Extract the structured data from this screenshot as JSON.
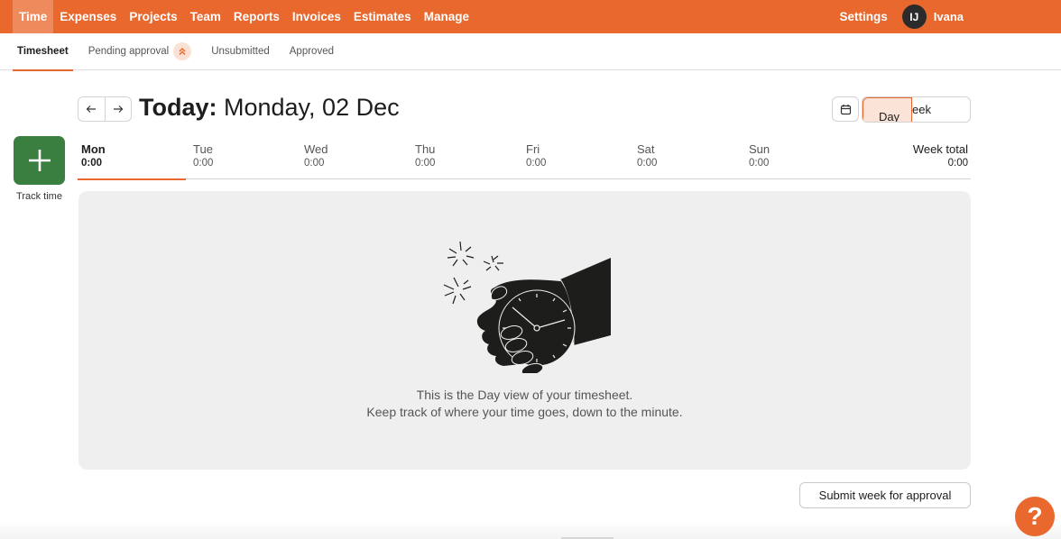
{
  "topnav": {
    "items": [
      {
        "label": "Time",
        "active": true
      },
      {
        "label": "Expenses"
      },
      {
        "label": "Projects"
      },
      {
        "label": "Team"
      },
      {
        "label": "Reports"
      },
      {
        "label": "Invoices"
      },
      {
        "label": "Estimates"
      },
      {
        "label": "Manage"
      }
    ],
    "settings_label": "Settings",
    "user": {
      "initials": "IJ",
      "name": "Ivana"
    }
  },
  "subnav": {
    "items": [
      {
        "label": "Timesheet",
        "active": true
      },
      {
        "label": "Pending approval",
        "badge_icon": "double-chevron-up-icon"
      },
      {
        "label": "Unsubmitted"
      },
      {
        "label": "Approved"
      }
    ]
  },
  "header": {
    "prev_icon": "arrow-left-icon",
    "next_icon": "arrow-right-icon",
    "title_prefix": "Today:",
    "title_date": " Monday, 02 Dec",
    "calendar_icon": "calendar-icon",
    "view_toggle": {
      "day_label": "Day",
      "week_label": "Week",
      "selected": "Day"
    }
  },
  "track_time": {
    "icon": "plus-icon",
    "label": "Track time"
  },
  "days": [
    {
      "name": "Mon",
      "total": "0:00",
      "active": true
    },
    {
      "name": "Tue",
      "total": "0:00"
    },
    {
      "name": "Wed",
      "total": "0:00"
    },
    {
      "name": "Thu",
      "total": "0:00"
    },
    {
      "name": "Fri",
      "total": "0:00"
    },
    {
      "name": "Sat",
      "total": "0:00"
    },
    {
      "name": "Sun",
      "total": "0:00"
    }
  ],
  "week_total": {
    "label": "Week total",
    "value": "0:00"
  },
  "empty_state": {
    "illustration": "hand-holding-stopwatch",
    "line1": "This is the Day view of your timesheet.",
    "line2": "Keep track of where your time goes, down to the minute."
  },
  "submit_label": "Submit week for approval",
  "help_label": "?",
  "colors": {
    "brand": "#e8682e",
    "track_button": "#3a7f3f",
    "avatar": "#2b2b2b"
  }
}
